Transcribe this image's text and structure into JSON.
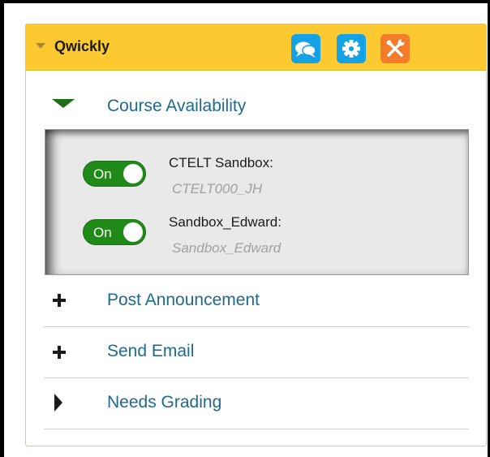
{
  "module": {
    "title": "Qwickly"
  },
  "header_buttons": {
    "chat_icon": "chat-bubbles-icon",
    "settings_icon": "gear-icon",
    "tools_icon": "tools-icon"
  },
  "sections": {
    "availability": {
      "label": "Course Availability",
      "state": "expanded"
    },
    "announcement": {
      "label": "Post Announcement",
      "state": "collapsed"
    },
    "email": {
      "label": "Send Email",
      "state": "collapsed"
    },
    "grading": {
      "label": "Needs Grading",
      "state": "collapsed"
    }
  },
  "courses": [
    {
      "name": "CTELT Sandbox:",
      "id": "CTELT000_JH",
      "toggle_label": "On",
      "available": true
    },
    {
      "name": "Sandbox_Edward:",
      "id": "Sandbox_Edward",
      "toggle_label": "On",
      "available": true
    }
  ],
  "colors": {
    "header_bg": "#fdc931",
    "accent_blue": "#14a2e6",
    "accent_orange": "#f47b2a",
    "toggle_on": "#1f8a17",
    "link_text": "#1e6a8f"
  }
}
